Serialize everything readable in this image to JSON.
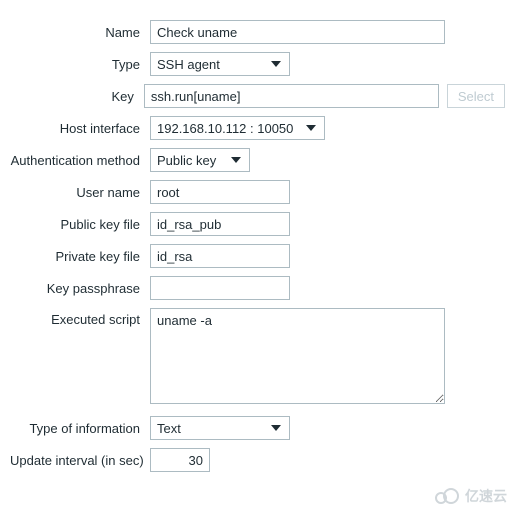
{
  "labels": {
    "name": "Name",
    "type": "Type",
    "key": "Key",
    "host_interface": "Host interface",
    "auth_method": "Authentication method",
    "user_name": "User name",
    "pub_key_file": "Public key file",
    "priv_key_file": "Private key file",
    "key_passphrase": "Key passphrase",
    "executed_script": "Executed script",
    "type_of_info": "Type of information",
    "update_interval": "Update interval (in sec)"
  },
  "values": {
    "name": "Check uname",
    "type": "SSH agent",
    "key": "ssh.run[uname]",
    "host_interface": "192.168.10.112 : 10050",
    "auth_method": "Public key",
    "user_name": "root",
    "pub_key_file": "id_rsa_pub",
    "priv_key_file": "id_rsa",
    "key_passphrase": "",
    "executed_script": "uname -a",
    "type_of_info": "Text",
    "update_interval": "30"
  },
  "buttons": {
    "select": "Select"
  },
  "watermark": "亿速云"
}
